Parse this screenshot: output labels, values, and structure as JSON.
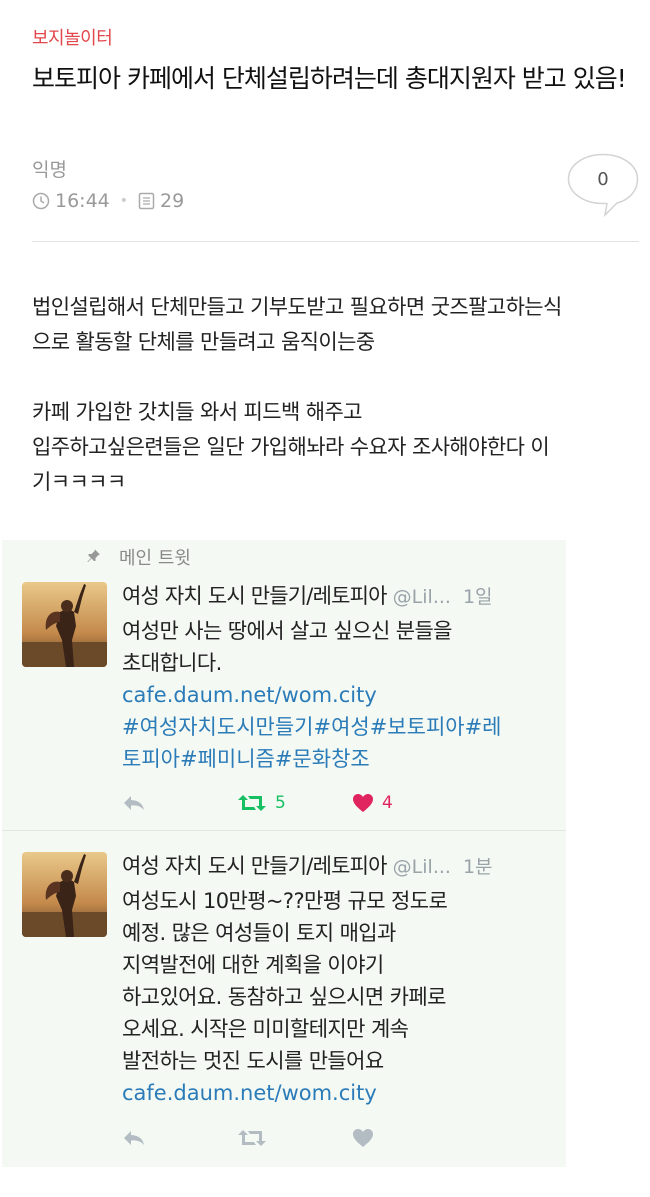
{
  "post": {
    "category": "보지놀이터",
    "title": "보토피아 카페에서 단체설립하려는데 총대지원자 받고 있음!",
    "author": "익명",
    "time": "16:44",
    "views": "29",
    "comment_count": "0",
    "body": [
      "법인설립해서 단체만들고 기부도받고 필요하면 굿즈팔고하는식",
      "으로 활동할 단체를 만들려고 움직이는중",
      "",
      "카페 가입한 갓치들 와서 피드백 해주고",
      "입주하고싶은련들은 일단 가입해놔라 수요자 조사해야한다 이",
      "기ㅋㅋㅋㅋ"
    ]
  },
  "embed": {
    "pinned_label": "메인 트윗",
    "tweets": [
      {
        "name": "여성 자치 도시 만들기/레토피아",
        "handle": "@Lil...",
        "time": "1일",
        "lines": [
          "여성만 사는 땅에서 살고 싶으신 분들을",
          "초대합니다."
        ],
        "link": "cafe.daum.net/wom.city",
        "hashtags": [
          "#여성자치도시만들기#여성#보토피아#레",
          "토피아#페미니즘#문화창조"
        ],
        "retweets": "5",
        "likes": "4"
      },
      {
        "name": "여성 자치 도시 만들기/레토피아",
        "handle": "@Lil...",
        "time": "1분",
        "lines": [
          "여성도시 10만평~??만평 규모 정도로",
          "예정. 많은 여성들이 토지 매입과",
          "지역발전에 대한 계획을 이야기",
          "하고있어요. 동참하고 싶으시면 카페로",
          "오세요. 시작은 미미할테지만 계속",
          "발전하는 멋진 도시를 만들어요"
        ],
        "link": "cafe.daum.net/wom.city",
        "retweets": "",
        "likes": ""
      }
    ]
  },
  "colors": {
    "category": "#e2474c",
    "link": "#2b7bb9",
    "retweet": "#17bf63",
    "like": "#e0245e",
    "embed_bg": "#f4faf3",
    "muted": "#999999"
  },
  "icons": [
    "clock-icon",
    "document-icon",
    "speech-bubble-icon",
    "pin-icon",
    "reply-icon",
    "retweet-icon",
    "heart-icon"
  ]
}
